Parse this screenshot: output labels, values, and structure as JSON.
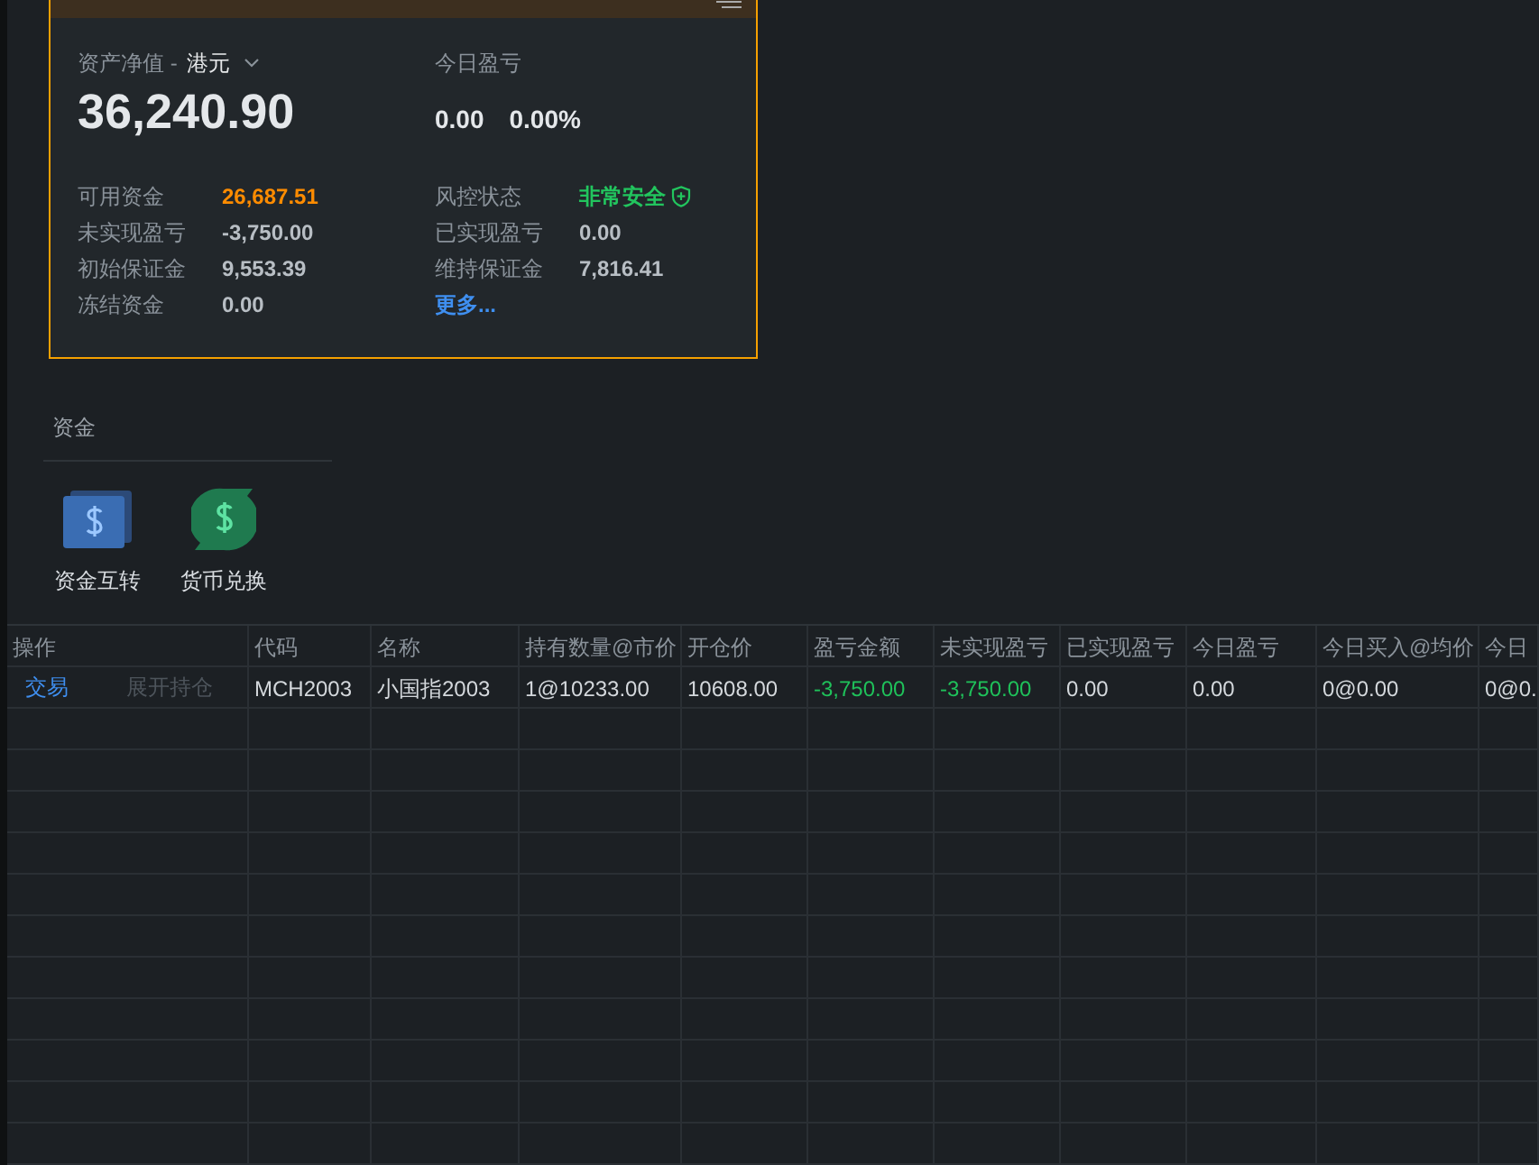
{
  "account_card": {
    "net_asset_label": "资产净值 -",
    "currency": "港元",
    "net_asset": "36,240.90",
    "today_pnl_label": "今日盈亏",
    "today_pnl": "0.00",
    "today_pnl_pct": "0.00%",
    "stats_left": [
      {
        "label": "可用资金",
        "value": "26,687.51",
        "kind": "highlight"
      },
      {
        "label": "未实现盈亏",
        "value": "-3,750.00",
        "kind": "plain"
      },
      {
        "label": "初始保证金",
        "value": "9,553.39",
        "kind": "plain"
      },
      {
        "label": "冻结资金",
        "value": "0.00",
        "kind": "plain"
      }
    ],
    "stats_right": [
      {
        "label": "风控状态",
        "value": "非常安全",
        "kind": "safe"
      },
      {
        "label": "已实现盈亏",
        "value": "0.00",
        "kind": "plain"
      },
      {
        "label": "维持保证金",
        "value": "7,816.41",
        "kind": "plain"
      },
      {
        "value": "更多...",
        "kind": "link"
      }
    ]
  },
  "funds": {
    "title": "资金",
    "actions": [
      {
        "label": "资金互转",
        "kind": "transfer"
      },
      {
        "label": "货币兑换",
        "kind": "exchange"
      }
    ]
  },
  "table": {
    "columns": [
      "操作",
      "代码",
      "名称",
      "持有数量@市价",
      "开仓价",
      "盈亏金额",
      "未实现盈亏",
      "已实现盈亏",
      "今日盈亏",
      "今日买入@均价",
      "今日"
    ],
    "rows": [
      {
        "cells": [
          {
            "kind": "actions",
            "links": [
              {
                "label": "交易",
                "disabled": false
              },
              {
                "label": "展开持仓",
                "disabled": true
              }
            ]
          },
          {
            "kind": "text",
            "text": "MCH2003",
            "loss": false
          },
          {
            "kind": "text",
            "text": "小国指2003",
            "loss": false
          },
          {
            "kind": "text",
            "text": "1@10233.00",
            "loss": false
          },
          {
            "kind": "text",
            "text": "10608.00",
            "loss": false
          },
          {
            "kind": "text",
            "text": "-3,750.00",
            "loss": true
          },
          {
            "kind": "text",
            "text": "-3,750.00",
            "loss": true
          },
          {
            "kind": "text",
            "text": "0.00",
            "loss": false
          },
          {
            "kind": "text",
            "text": "0.00",
            "loss": false
          },
          {
            "kind": "text",
            "text": "0@0.00",
            "loss": false
          },
          {
            "kind": "text",
            "text": "0@0.",
            "loss": false
          }
        ]
      }
    ]
  }
}
